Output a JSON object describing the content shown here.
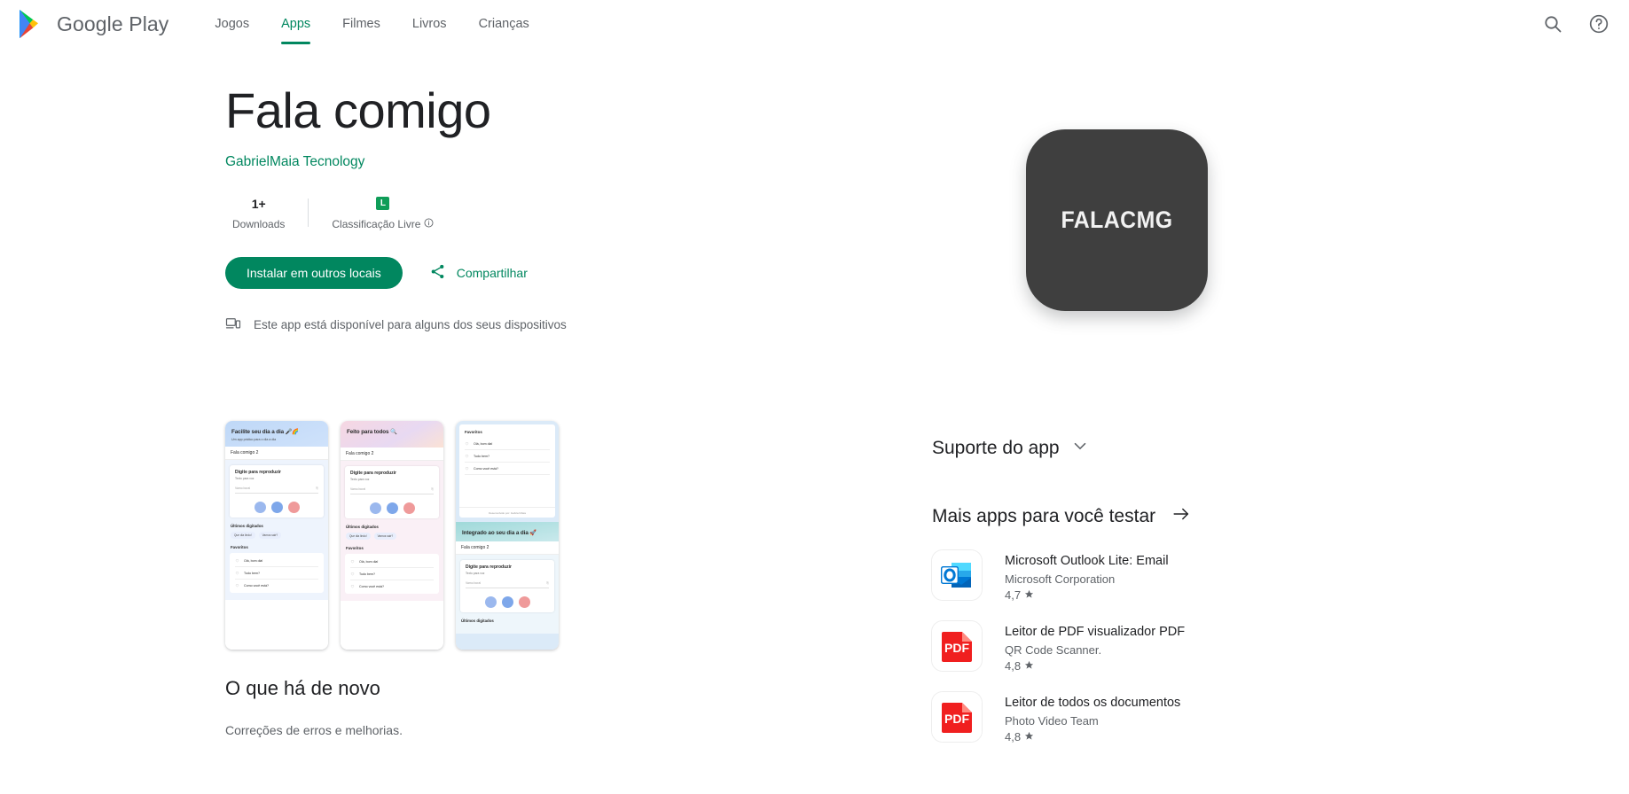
{
  "header": {
    "brand": "Google Play",
    "nav": [
      {
        "label": "Jogos",
        "active": false
      },
      {
        "label": "Apps",
        "active": true
      },
      {
        "label": "Filmes",
        "active": false
      },
      {
        "label": "Livros",
        "active": false
      },
      {
        "label": "Crianças",
        "active": false
      }
    ],
    "search_icon": "search-icon",
    "help_icon": "help-icon"
  },
  "app": {
    "title": "Fala comigo",
    "developer": "GabrielMaia Tecnology",
    "icon_text": "FALACMG",
    "icon_color": "#3f3f3f",
    "stats": {
      "downloads_value": "1+",
      "downloads_label": "Downloads",
      "rating_badge": "L",
      "rating_label": "Classificação Livre",
      "rating_info_icon": "info-icon"
    },
    "install_label": "Instalar em outros locais",
    "share_label": "Compartilhar",
    "device_note": "Este app está disponível para alguns dos seus dispositivos"
  },
  "screenshots": [
    {
      "hero_title": "Facilite seu dia a dia 🎤🌈",
      "hero_sub": "Um app prático para o dia a dia",
      "app_name": "Fala comigo 2",
      "card_title": "Digite para reproduzir",
      "card_sub": "Texto para voz",
      "input_placeholder": "Vamo bora!",
      "section_recent": "Últimos digitados",
      "chips": [
        "Que dia lindo!",
        "Vamos sair?"
      ],
      "section_fav": "Favoritos",
      "favorites": [
        "Olá, bom dia!",
        "Tudo bem?",
        "Como você está?"
      ]
    },
    {
      "hero_title": "Feito para todos 🔍",
      "app_name": "Fala comigo 2",
      "card_title": "Digite para reproduzir",
      "card_sub": "Texto para voz",
      "input_placeholder": "Vamo bora!",
      "section_recent": "Últimos digitados",
      "chips": [
        "Que dia lindo!",
        "Vamos sair?"
      ],
      "section_fav": "Favoritos",
      "favorites": [
        "Olá, bom dia!",
        "Tudo bem?",
        "Como você está?"
      ]
    },
    {
      "section_fav": "Favoritos",
      "favorites": [
        "Olá, bom dia!",
        "Tudo bem?",
        "Como você está?"
      ],
      "footer": "Desenvolvido por: Gabriel Maia",
      "hero_title": "Integrado ao seu dia a dia 🚀",
      "app_name": "Fala comigo 2",
      "card_title": "Digite para reproduzir",
      "card_sub": "Texto para voz",
      "input_placeholder": "Vamo bora!",
      "section_recent": "Últimos digitados"
    }
  ],
  "whats_new": {
    "title": "O que há de novo",
    "body": "Correções de erros e melhorias."
  },
  "sidebar": {
    "support_title": "Suporte do app",
    "support_chevron": "chevron-down-icon",
    "more_title": "Mais apps para você testar",
    "more_arrow": "arrow-right-icon",
    "apps": [
      {
        "name": "Microsoft Outlook Lite: Email",
        "developer": "Microsoft Corporation",
        "rating": "4,7",
        "icon": "outlook-icon"
      },
      {
        "name": "Leitor de PDF visualizador PDF",
        "developer": "QR Code Scanner.",
        "rating": "4,8",
        "icon": "pdf-icon"
      },
      {
        "name": "Leitor de todos os documentos",
        "developer": "Photo Video Team",
        "rating": "4,8",
        "icon": "pdf-icon"
      }
    ]
  },
  "colors": {
    "accent_green": "#01875f",
    "rating_green": "#0f9d58",
    "text_secondary": "#5f6368"
  }
}
